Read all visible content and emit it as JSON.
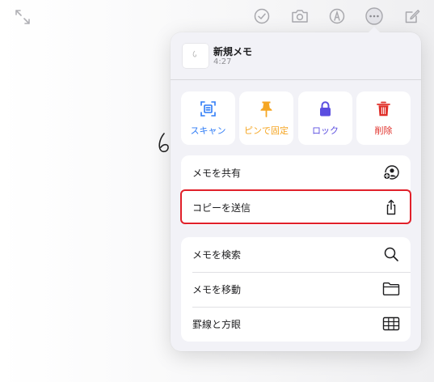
{
  "note": {
    "title": "新規メモ",
    "time": "4:27"
  },
  "tiles": [
    {
      "label": "スキャン",
      "icon": "scan-icon",
      "color": "#2f7cf6"
    },
    {
      "label": "ピンで固定",
      "icon": "pin-icon",
      "color": "#f5a623"
    },
    {
      "label": "ロック",
      "icon": "lock-icon",
      "color": "#5b4ee0"
    },
    {
      "label": "削除",
      "icon": "trash-icon",
      "color": "#e0302a"
    }
  ],
  "share_group": {
    "items": [
      {
        "label": "メモを共有",
        "icon": "person-add-icon"
      },
      {
        "label": "コピーを送信",
        "icon": "share-icon"
      }
    ]
  },
  "tools_group": {
    "items": [
      {
        "label": "メモを検索",
        "icon": "search-icon"
      },
      {
        "label": "メモを移動",
        "icon": "folder-icon"
      },
      {
        "label": "罫線と方眼",
        "icon": "grid-icon"
      }
    ]
  },
  "toolbar": {
    "icons": [
      "expand-icon",
      "checklist-icon",
      "camera-icon",
      "markup-icon",
      "more-icon",
      "compose-icon"
    ]
  },
  "colors": {
    "highlight": "#e1202a",
    "popover_bg": "#f2f2f7",
    "toolbar_icon": "#a8a8ad"
  }
}
